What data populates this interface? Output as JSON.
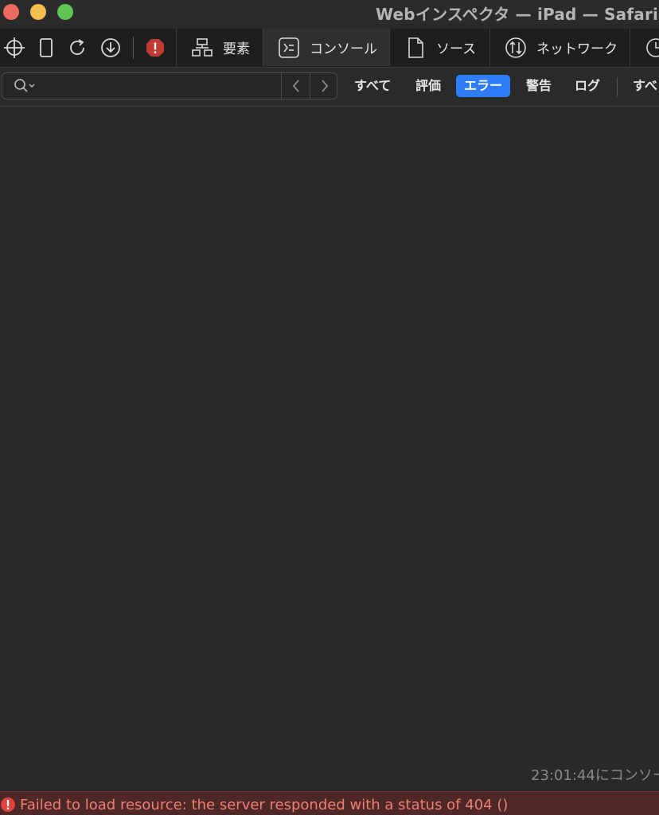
{
  "window": {
    "title": "Webインスペクタ — iPad — Safari —"
  },
  "toolbar": {
    "icons": [
      "crosshair-icon",
      "device-icon",
      "reload-icon",
      "download-icon",
      "error-stop-icon"
    ],
    "tabs": [
      {
        "label": "要素",
        "icon": "elements-icon"
      },
      {
        "label": "コンソール",
        "icon": "console-icon",
        "selected": true
      },
      {
        "label": "ソース",
        "icon": "document-icon"
      },
      {
        "label": "ネットワーク",
        "icon": "network-icon"
      },
      {
        "label": "",
        "icon": "clock-icon"
      }
    ]
  },
  "filter": {
    "search_placeholder": "",
    "levels": [
      "すべて",
      "評価",
      "エラー",
      "警告",
      "ログ"
    ],
    "active_level": "エラー",
    "trailing": "すべ"
  },
  "console": {
    "cleared_timestamp": "23:01:44にコンソー"
  },
  "status": {
    "error_message": "Failed to load resource: the server responded with a status of 404 ()"
  },
  "colors": {
    "accent": "#2f7df6",
    "error_text": "#f07f74",
    "error_bg": "#4e2727"
  }
}
